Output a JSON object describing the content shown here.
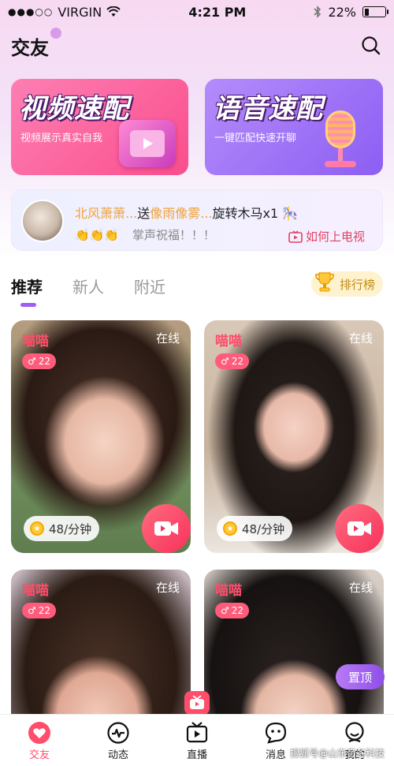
{
  "status_bar": {
    "signal": "●●●○○",
    "carrier": "VIRGIN",
    "time": "4:21 PM",
    "battery": "22%",
    "battery_level": 0.22
  },
  "header": {
    "title": "交友"
  },
  "quick_match": {
    "video": {
      "title": "视频速配",
      "subtitle": "视频展示真实自我"
    },
    "voice": {
      "title": "语音速配",
      "subtitle": "一键匹配快速开聊"
    }
  },
  "gift_banner": {
    "sender": "北风萧萧...",
    "verb": "送",
    "receiver": "像雨像雾...",
    "gift": "旋转木马x1",
    "emoji": "👏👏👏",
    "blessing": "掌声祝福！！！",
    "link": "如何上电视"
  },
  "tabs": [
    {
      "label": "推荐",
      "active": true
    },
    {
      "label": "新人",
      "active": false
    },
    {
      "label": "附近",
      "active": false
    }
  ],
  "rank_button": "排行榜",
  "cards": [
    {
      "name": "喵喵",
      "status": "在线",
      "gender": "♂",
      "age": "22",
      "price": "48/分钟"
    },
    {
      "name": "喵喵",
      "status": "在线",
      "gender": "♂",
      "age": "22",
      "price": "48/分钟"
    },
    {
      "name": "喵喵",
      "status": "在线",
      "gender": "♂",
      "age": "22"
    },
    {
      "name": "喵喵",
      "status": "在线",
      "gender": "♂",
      "age": "22"
    }
  ],
  "pin_button": "置顶",
  "bottom_nav": [
    {
      "label": "交友",
      "icon": "heart-icon",
      "active": true
    },
    {
      "label": "动态",
      "icon": "pulse-icon",
      "active": false
    },
    {
      "label": "直播",
      "icon": "tv-icon",
      "active": false
    },
    {
      "label": "消息",
      "icon": "chat-face-icon",
      "active": false
    },
    {
      "label": "我的",
      "icon": "person-icon",
      "active": false
    }
  ],
  "watermark": "搜狐号@山东帝谷科技",
  "colors": {
    "accent": "#ff4d6a",
    "purple": "#a15ef0",
    "gold": "#c48a12"
  }
}
